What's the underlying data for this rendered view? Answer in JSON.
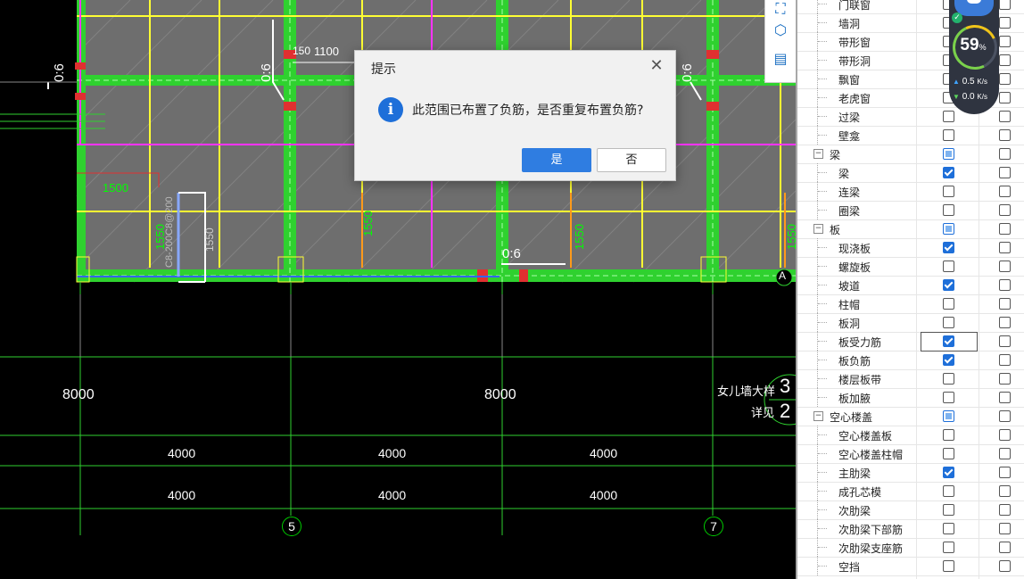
{
  "cad": {
    "dims_row1": [
      "8000",
      "8000"
    ],
    "dims_row2": [
      "4000",
      "4000",
      "4000"
    ],
    "dims_row3": [
      "4000",
      "4000",
      "4000"
    ],
    "axis_labels": [
      "5",
      "7",
      "A"
    ],
    "labels": {
      "dim_150": "150",
      "dim_1100": "1100",
      "dim_1500": "1500",
      "dim_1550_a": "1550",
      "dim_1550_b": "1550",
      "dim_1550_c": "1550",
      "dim_1550_side": "1550",
      "dim_1550_mid": "1550",
      "rebar_spec": "C8-200C8@200",
      "ratio_1": "0:6",
      "ratio_2": "0:6",
      "ratio_3": "0:6",
      "ratio_4": "0:6",
      "parapet": "女儿墙大样",
      "detail": "详见",
      "bubble_3": "3",
      "bubble_2": "2"
    }
  },
  "dialog": {
    "title": "提示",
    "message": "此范围已布置了负筋，是否重复布置负筋?",
    "yes": "是",
    "no": "否",
    "close": "✕"
  },
  "speed_widget": {
    "percent": "59",
    "percent_unit": "%",
    "upload": "0.5",
    "download": "0.0",
    "unit": "K/s"
  },
  "panel": {
    "rows": [
      {
        "label": "门联窗",
        "indent": 2,
        "c1": "none",
        "c2": "none"
      },
      {
        "label": "墙洞",
        "indent": 2,
        "c1": "none",
        "c2": "none"
      },
      {
        "label": "带形窗",
        "indent": 2,
        "c1": "none",
        "c2": "none"
      },
      {
        "label": "带形洞",
        "indent": 2,
        "c1": "none",
        "c2": "none"
      },
      {
        "label": "飘窗",
        "indent": 2,
        "c1": "none",
        "c2": "none"
      },
      {
        "label": "老虎窗",
        "indent": 2,
        "c1": "none",
        "c2": "none"
      },
      {
        "label": "过梁",
        "indent": 2,
        "c1": "none",
        "c2": "none"
      },
      {
        "label": "壁龛",
        "indent": 2,
        "c1": "none",
        "c2": "none"
      },
      {
        "label": "梁",
        "indent": 1,
        "c1": "partial",
        "c2": "none",
        "group": true
      },
      {
        "label": "梁",
        "indent": 2,
        "c1": "checked",
        "c2": "none"
      },
      {
        "label": "连梁",
        "indent": 2,
        "c1": "none",
        "c2": "none"
      },
      {
        "label": "圈梁",
        "indent": 2,
        "c1": "none",
        "c2": "none"
      },
      {
        "label": "板",
        "indent": 1,
        "c1": "partial",
        "c2": "none",
        "group": true
      },
      {
        "label": "现浇板",
        "indent": 2,
        "c1": "checked",
        "c2": "none"
      },
      {
        "label": "螺旋板",
        "indent": 2,
        "c1": "none",
        "c2": "none"
      },
      {
        "label": "坡道",
        "indent": 2,
        "c1": "checked",
        "c2": "none"
      },
      {
        "label": "柱帽",
        "indent": 2,
        "c1": "none",
        "c2": "none"
      },
      {
        "label": "板洞",
        "indent": 2,
        "c1": "none",
        "c2": "none"
      },
      {
        "label": "板受力筋",
        "indent": 2,
        "c1": "checked",
        "c2": "none",
        "focus": true
      },
      {
        "label": "板负筋",
        "indent": 2,
        "c1": "checked",
        "c2": "none"
      },
      {
        "label": "楼层板带",
        "indent": 2,
        "c1": "none",
        "c2": "none"
      },
      {
        "label": "板加腋",
        "indent": 2,
        "c1": "none",
        "c2": "none"
      },
      {
        "label": "空心楼盖",
        "indent": 1,
        "c1": "partial",
        "c2": "none",
        "group": true
      },
      {
        "label": "空心楼盖板",
        "indent": 2,
        "c1": "none",
        "c2": "none"
      },
      {
        "label": "空心楼盖柱帽",
        "indent": 2,
        "c1": "none",
        "c2": "none"
      },
      {
        "label": "主肋梁",
        "indent": 2,
        "c1": "checked",
        "c2": "none"
      },
      {
        "label": "成孔芯模",
        "indent": 2,
        "c1": "none",
        "c2": "none"
      },
      {
        "label": "次肋梁",
        "indent": 2,
        "c1": "none",
        "c2": "none"
      },
      {
        "label": "次肋梁下部筋",
        "indent": 2,
        "c1": "none",
        "c2": "none"
      },
      {
        "label": "次肋梁支座筋",
        "indent": 2,
        "c1": "none",
        "c2": "none"
      },
      {
        "label": "空挡",
        "indent": 2,
        "c1": "none",
        "c2": "none"
      }
    ]
  }
}
